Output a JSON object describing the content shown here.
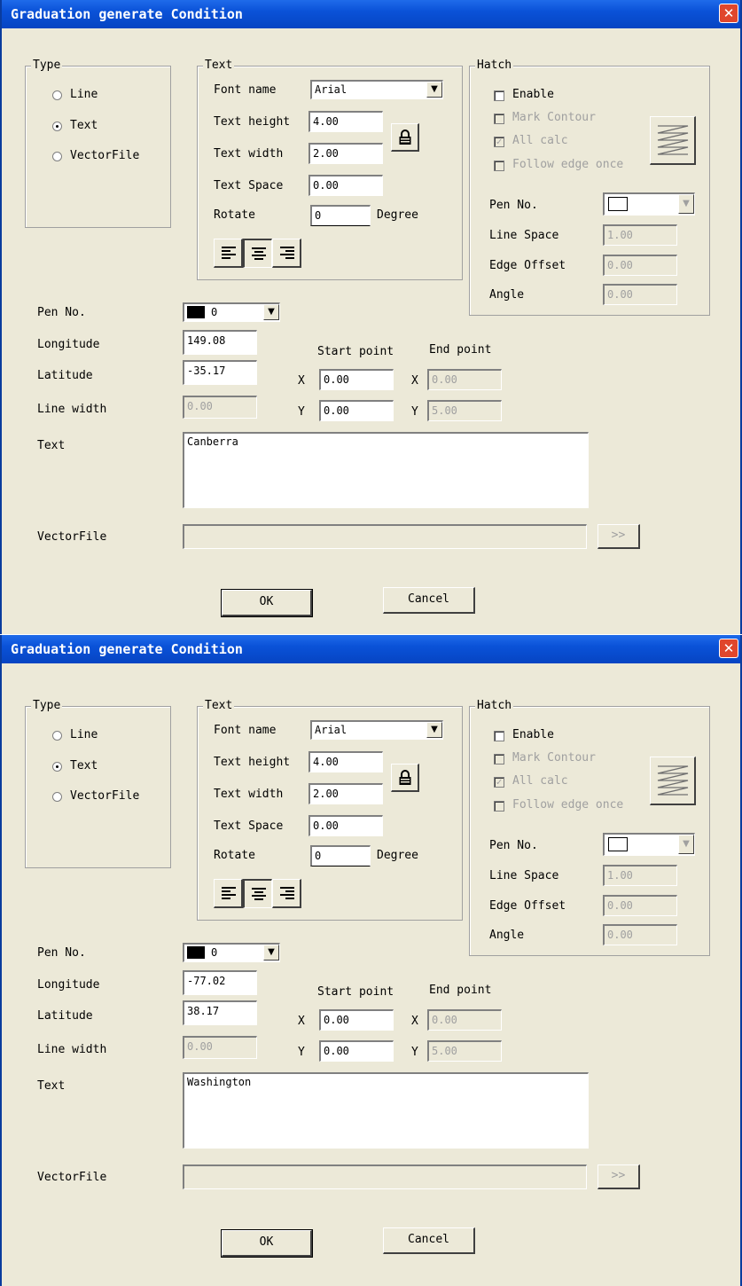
{
  "dialogs": [
    {
      "title": "Graduation generate Condition",
      "close_glyph": "✕",
      "type_group": {
        "title": "Type",
        "options": [
          "Line",
          "Text",
          "VectorFile"
        ],
        "selected": "Text"
      },
      "text_group": {
        "title": "Text",
        "font_name_label": "Font name",
        "font_name_value": "Arial",
        "text_height_label": "Text height",
        "text_height_value": "4.00",
        "text_width_label": "Text width",
        "text_width_value": "2.00",
        "text_space_label": "Text Space",
        "text_space_value": "0.00",
        "rotate_label": "Rotate",
        "rotate_value": "0",
        "degree_label": "Degree",
        "lock_icon": "lock-icon",
        "align_icons": [
          "align-left-icon",
          "align-center-icon",
          "align-right-icon"
        ],
        "align_selected": "align-center-icon"
      },
      "hatch_group": {
        "title": "Hatch",
        "enable_label": "Enable",
        "enable_checked": false,
        "mark_contour_label": "Mark Contour",
        "mark_contour_checked": false,
        "all_calc_label": "All calc",
        "all_calc_checked": true,
        "follow_edge_label": "Follow edge once",
        "follow_edge_checked": false,
        "hatch_icon": "hatch-pattern-icon",
        "pen_no_label": "Pen No.",
        "pen_color": "#ffffff",
        "line_space_label": "Line Space",
        "line_space_value": "1.00",
        "edge_offset_label": "Edge Offset",
        "edge_offset_value": "0.00",
        "angle_label": "Angle",
        "angle_value": "0.00"
      },
      "pen_no_label": "Pen No.",
      "pen_no_value": "0",
      "pen_no_color": "#000000",
      "longitude_label": "Longitude",
      "longitude_value": "149.08",
      "latitude_label": "Latitude",
      "latitude_value": "-35.17",
      "line_width_label": "Line width",
      "line_width_value": "0.00",
      "start_point_label": "Start point",
      "end_point_label": "End point",
      "start_x_label": "X",
      "start_x_value": "0.00",
      "start_y_label": "Y",
      "start_y_value": "0.00",
      "end_x_label": "X",
      "end_x_value": "0.00",
      "end_y_label": "Y",
      "end_y_value": "5.00",
      "text_label": "Text",
      "text_value": "Canberra",
      "vectorfile_label": "VectorFile",
      "vectorfile_value": "",
      "browse_label": ">>",
      "ok_label": "OK",
      "cancel_label": "Cancel"
    },
    {
      "title": "Graduation generate Condition",
      "close_glyph": "✕",
      "type_group": {
        "title": "Type",
        "options": [
          "Line",
          "Text",
          "VectorFile"
        ],
        "selected": "Text"
      },
      "text_group": {
        "title": "Text",
        "font_name_label": "Font name",
        "font_name_value": "Arial",
        "text_height_label": "Text height",
        "text_height_value": "4.00",
        "text_width_label": "Text width",
        "text_width_value": "2.00",
        "text_space_label": "Text Space",
        "text_space_value": "0.00",
        "rotate_label": "Rotate",
        "rotate_value": "0",
        "degree_label": "Degree",
        "lock_icon": "lock-icon",
        "align_icons": [
          "align-left-icon",
          "align-center-icon",
          "align-right-icon"
        ],
        "align_selected": "align-center-icon"
      },
      "hatch_group": {
        "title": "Hatch",
        "enable_label": "Enable",
        "enable_checked": false,
        "mark_contour_label": "Mark Contour",
        "mark_contour_checked": false,
        "all_calc_label": "All calc",
        "all_calc_checked": true,
        "follow_edge_label": "Follow edge once",
        "follow_edge_checked": false,
        "hatch_icon": "hatch-pattern-icon",
        "pen_no_label": "Pen No.",
        "pen_color": "#ffffff",
        "line_space_label": "Line Space",
        "line_space_value": "1.00",
        "edge_offset_label": "Edge Offset",
        "edge_offset_value": "0.00",
        "angle_label": "Angle",
        "angle_value": "0.00"
      },
      "pen_no_label": "Pen No.",
      "pen_no_value": "0",
      "pen_no_color": "#000000",
      "longitude_label": "Longitude",
      "longitude_value": "-77.02",
      "latitude_label": "Latitude",
      "latitude_value": "38.17",
      "line_width_label": "Line width",
      "line_width_value": "0.00",
      "start_point_label": "Start point",
      "end_point_label": "End point",
      "start_x_label": "X",
      "start_x_value": "0.00",
      "start_y_label": "Y",
      "start_y_value": "0.00",
      "end_x_label": "X",
      "end_x_value": "0.00",
      "end_y_label": "Y",
      "end_y_value": "5.00",
      "text_label": "Text",
      "text_value": "Washington",
      "vectorfile_label": "VectorFile",
      "vectorfile_value": "",
      "browse_label": ">>",
      "ok_label": "OK",
      "cancel_label": "Cancel"
    }
  ],
  "colors": {
    "titlebar": "#0a52d8",
    "dialog_bg": "#ece9d8",
    "close_button": "#e0462c",
    "disabled_text": "#a0a0a0"
  }
}
